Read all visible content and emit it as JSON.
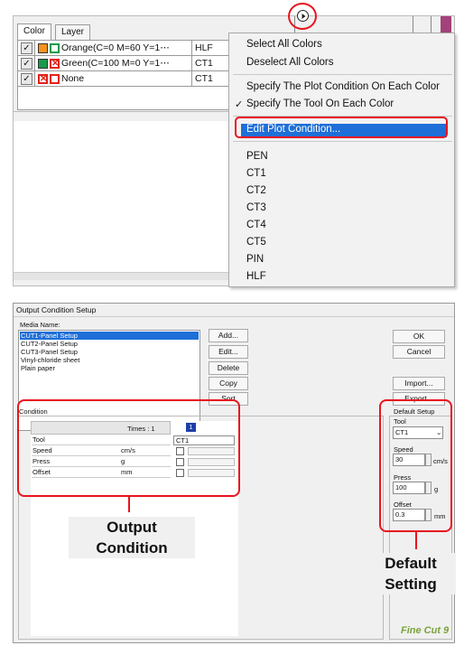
{
  "tabs": [
    "Color",
    "Layer"
  ],
  "color_rows": [
    {
      "name": "Orange(C=0 M=60 Y=1⋯",
      "tool": "HLF",
      "swatch_fill": "#f7941d",
      "swatch_outline": "#1a9a4a",
      "checked": "✓"
    },
    {
      "name": "Green(C=100 M=0 Y=1⋯",
      "tool": "CT1",
      "swatch_fill": "#1a9a4a",
      "swatch_outline": "#e2231a",
      "checked": "✓"
    },
    {
      "name": "None",
      "tool": "CT1",
      "swatch_fill": "#ffffff",
      "swatch_outline": "#e2231a",
      "checked": "✓"
    }
  ],
  "menu": {
    "items": [
      "Select All Colors",
      "Deselect All Colors",
      "Specify The Plot Condition On Each Color",
      "Specify The Tool On Each Color",
      "Edit Plot Condition..."
    ],
    "check_mark": "✓",
    "tools": [
      "PEN",
      "CT1",
      "CT2",
      "CT3",
      "CT4",
      "CT5",
      "PIN",
      "HLF"
    ]
  },
  "dialog": {
    "title": "Output Condition Setup",
    "media_label": "Media Name:",
    "media": [
      "CUT1-Panel Setup",
      "CUT2-Panel Setup",
      "CUT3-Panel Setup",
      "Vinyl-chloride sheet",
      "Plain paper"
    ],
    "buttons": [
      "Add...",
      "Edit...",
      "Delete",
      "Copy",
      "Sort"
    ],
    "ok": "OK",
    "cancel": "Cancel",
    "import": "Import...",
    "export": "Export...",
    "condition_label": "Condition",
    "times_label": "Times : 1",
    "times_value": "1",
    "grid_rows": [
      {
        "label": "Tool",
        "unit": ""
      },
      {
        "label": "Speed",
        "unit": "cm/s"
      },
      {
        "label": "Press",
        "unit": "g"
      },
      {
        "label": "Offset",
        "unit": "mm"
      }
    ],
    "tool_select": "CT1",
    "default": {
      "title": "Default Setup",
      "tool_label": "Tool",
      "tool_value": "CT1",
      "speed_label": "Speed",
      "speed_value": "30",
      "speed_unit": "cm/s",
      "press_label": "Press",
      "press_value": "100",
      "press_unit": "g",
      "offset_label": "Offset",
      "offset_value": "0.3",
      "offset_unit": "mm"
    },
    "logo": "Fine Cut 9"
  },
  "callouts": {
    "output_1": "Output",
    "output_2": "Condition",
    "default_1": "Default",
    "default_2": "Setting"
  },
  "colors": {
    "highlight": "#e8141e",
    "selection": "#1e6fd8"
  }
}
